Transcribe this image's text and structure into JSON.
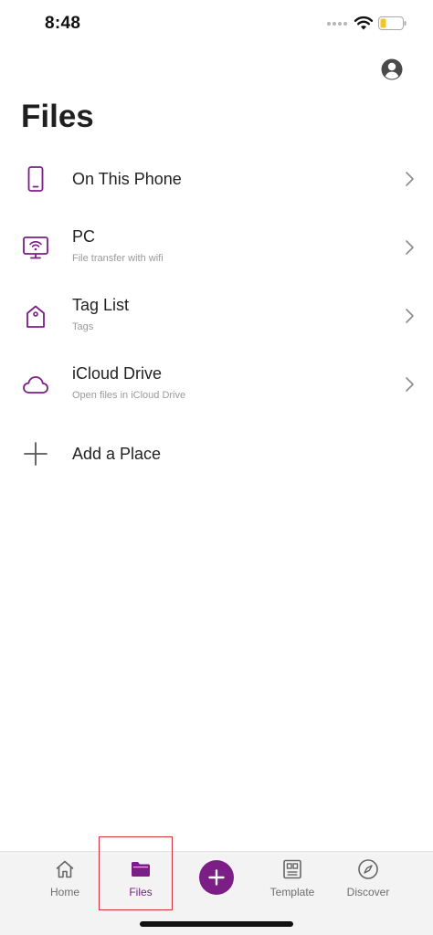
{
  "status_bar": {
    "time": "8:48",
    "battery_color": "#f3c623"
  },
  "header": {
    "title": "Files",
    "account_icon": "account-circle-icon"
  },
  "accent_color": "#7b1f86",
  "places": [
    {
      "label": "On This Phone",
      "subtitle": "",
      "icon": "phone-icon"
    },
    {
      "label": "PC",
      "subtitle": "File transfer with wifi",
      "icon": "monitor-wifi-icon"
    },
    {
      "label": "Tag List",
      "subtitle": "Tags",
      "icon": "tag-icon"
    },
    {
      "label": "iCloud Drive",
      "subtitle": "Open files in iCloud Drive",
      "icon": "cloud-icon"
    }
  ],
  "add_place": {
    "label": "Add a Place",
    "icon": "plus-icon"
  },
  "tabs": [
    {
      "label": "Home",
      "icon": "home-icon",
      "active": false
    },
    {
      "label": "Files",
      "icon": "folder-icon",
      "active": true
    },
    {
      "label": "Template",
      "icon": "template-icon",
      "active": false
    },
    {
      "label": "Discover",
      "icon": "compass-icon",
      "active": false
    }
  ],
  "fab": {
    "icon": "plus-icon"
  }
}
